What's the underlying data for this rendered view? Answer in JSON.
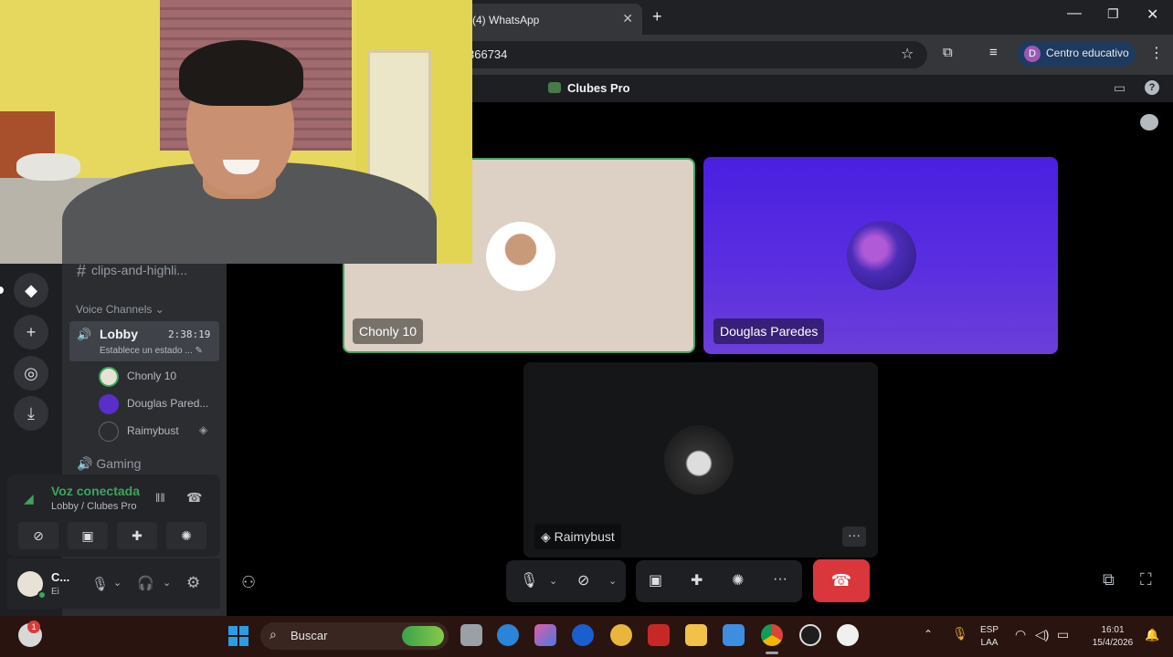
{
  "browser": {
    "tab_title": "(4) WhatsApp",
    "tab_close": "✕",
    "new_tab": "+",
    "url_fragment": "366734",
    "profile_label": "Centro educativo",
    "profile_initial": "D"
  },
  "window_controls": {
    "minimize": "—",
    "maximize": "❐",
    "close": "✕"
  },
  "discord": {
    "server_name": "Clubes Pro",
    "channels": {
      "text_channel": "clips-and-highli...",
      "voice_header": "Voice Channels",
      "lobby": {
        "name": "Lobby",
        "timer": "2:38:19",
        "status": "Establece un estado ..."
      },
      "members": [
        "Chonly 10",
        "Douglas Pared...",
        "Raimybust"
      ],
      "gaming": "Gaming"
    },
    "voice_panel": {
      "title": "Voz conectada",
      "subtitle": "Lobby / Clubes Pro"
    },
    "user_panel": {
      "name": "C...",
      "status": "Ei"
    },
    "tiles": [
      {
        "label": "Chonly 10"
      },
      {
        "label": "Douglas Paredes"
      },
      {
        "label": "Raimybust",
        "more": "···"
      }
    ],
    "accent_colors": {
      "speaking_green": "#3ba55c",
      "hangup_red": "#da373c",
      "douglas_tile": "#4a1fe0"
    }
  },
  "taskbar": {
    "search_placeholder": "Buscar",
    "weather_badge": "1",
    "language_line1": "ESP",
    "language_line2": "LAA",
    "time": "16:01",
    "date": "15/4/2026"
  },
  "icons": {
    "hash": "#",
    "speaker": "🔊",
    "chevron": "⌄",
    "star": "☆",
    "dots_vertical": "⋮",
    "dots_horizontal": "···",
    "pencil": "✎",
    "gear": "⚙",
    "phone": "☎",
    "download": "⤓",
    "plus": "+",
    "compass": "◎",
    "mic": "🎙",
    "headset": "🎧",
    "caret": "⌄",
    "popout": "⧉",
    "fullscreen": "⛶",
    "search": "⌕",
    "chevron_up": "⌃",
    "bell": "🔔"
  }
}
